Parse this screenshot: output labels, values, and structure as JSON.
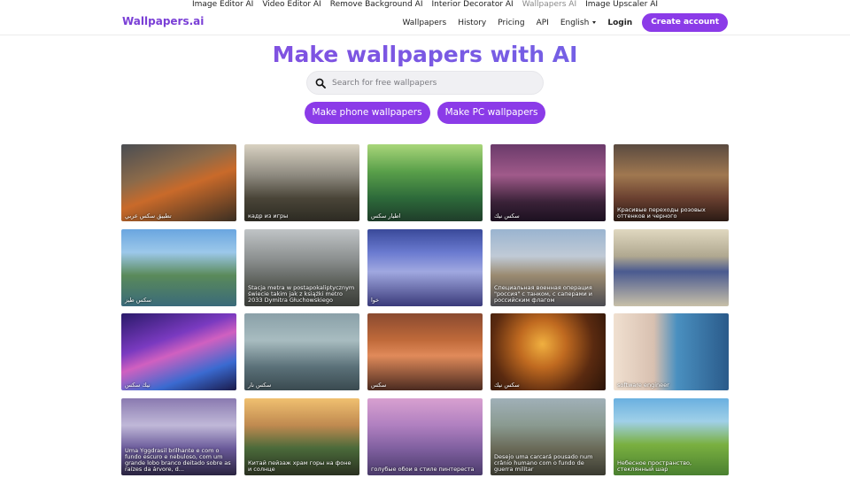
{
  "top_links": [
    {
      "label": "Image Editor AI",
      "active": false
    },
    {
      "label": "Video Editor AI",
      "active": false
    },
    {
      "label": "Remove Background AI",
      "active": false
    },
    {
      "label": "Interior Decorator AI",
      "active": false
    },
    {
      "label": "Wallpapers AI",
      "active": true
    },
    {
      "label": "Image Upscaler AI",
      "active": false
    }
  ],
  "header": {
    "logo": "Wallpapers.ai",
    "nav": {
      "wallpapers": "Wallpapers",
      "history": "History",
      "pricing": "Pricing",
      "api": "API",
      "language": "English",
      "login": "Login",
      "create_account": "Create account"
    }
  },
  "hero": {
    "title": "Make wallpapers with AI",
    "search_placeholder": "Search for free wallpapers",
    "phone_button": "Make phone wallpapers",
    "pc_button": "Make PC wallpapers"
  },
  "colors": {
    "accent": "#8b3be8",
    "logo": "#7a3fd6"
  },
  "icons": {
    "search": "search-icon",
    "dropdown": "chevron-down-icon"
  },
  "wallpapers": [
    {
      "caption": "تطبيق سكس عربي",
      "bg": "linear-gradient(160deg,#4a4d52 0%,#8b6a4a 35%,#c96a2a 55%,#3a2e22 100%)"
    },
    {
      "caption": "кадр из игры",
      "bg": "linear-gradient(180deg,#d9d2c2 0%,#8e8a80 40%,#4a4538 70%,#2c2a22 100%)"
    },
    {
      "caption": "اطيار سكس",
      "bg": "linear-gradient(180deg,#a9d67a 0%,#5aa04a 35%,#2d6a3a 70%,#1f3d2a 100%)"
    },
    {
      "caption": "سكس نيك",
      "bg": "linear-gradient(180deg,#6a3a6a 0%,#a05a8a 40%,#3a2238 75%,#1c1020 100%)"
    },
    {
      "caption": "Красивые переходы розовых оттенков и черного",
      "bg": "linear-gradient(180deg,#5a4a40 0%,#a07850 40%,#6a4030 70%,#2a1a14 100%)"
    },
    {
      "caption": "سكس طيز",
      "bg": "linear-gradient(180deg,#6aa6e0 0%,#9cc8ea 30%,#5a8a5a 60%,#3a6a7a 100%)"
    },
    {
      "caption": "Stacja metra w postapokaliptycznym świecie takim jak z książki metro 2033 Dymitra Głuchowskiego",
      "bg": "linear-gradient(180deg,#c0c4c6 0%,#8a8e8e 40%,#5a5e58 70%,#3a3c38 100%)"
    },
    {
      "caption": "خوا",
      "bg": "linear-gradient(180deg,#3a4a9a 0%,#6a7ad0 30%,#a0a8e0 55%,#3a3a7a 100%)"
    },
    {
      "caption": "Специальная военная операция \"россия\" с танком, с саперами и российским флагом",
      "bg": "linear-gradient(180deg,#9ab4d0 0%,#c0cad6 35%,#9a8a70 60%,#4a4a50 100%)"
    },
    {
      "caption": "",
      "bg": "linear-gradient(180deg,#e0d8c0 0%,#b0a890 35%,#4a5a90 55%,#c8c0a8 100%)"
    },
    {
      "caption": "نيك سكس",
      "bg": "linear-gradient(160deg,#2a1a6a 0%,#7a3ac0 35%,#d060c0 50%,#3a6ad0 75%,#1a1a4a 100%)"
    },
    {
      "caption": "سكس نار",
      "bg": "linear-gradient(180deg,#8aa0a8 0%,#a8bcc0 35%,#5a7078 70%,#3a4a50 100%)"
    },
    {
      "caption": "سكس",
      "bg": "linear-gradient(180deg,#8a4a30 0%,#c06a3a 35%,#e08a5a 55%,#4a2a20 100%)"
    },
    {
      "caption": "سكس نيك",
      "bg": "radial-gradient(circle at 45% 40%,#f0b040 0%,#c06a20 30%,#5a2a10 65%,#2a1408 100%)"
    },
    {
      "caption": "software engineer",
      "bg": "linear-gradient(90deg,#f0e0d0 0%,#d8c0b0 35%,#4a90c0 55%,#2a5a8a 100%)"
    },
    {
      "caption": "Uma Yggdrasil brilhante e com o fundo escuro e nebuloso, com um grande lobo branco deitado sobre as raízes da árvore, d...",
      "bg": "linear-gradient(180deg,#8a7ab0 0%,#c0b8d8 35%,#6a5a9a 65%,#2a2440 100%)"
    },
    {
      "caption": "Китай пейзаж храм горы на фоне и солнце",
      "bg": "linear-gradient(180deg,#f0c070 0%,#c08a50 35%,#4a6a3a 65%,#2a3020 100%)"
    },
    {
      "caption": "голубые обои в стиле пинтереста",
      "bg": "linear-gradient(180deg,#d8a0d0 0%,#b080c0 35%,#8060a0 65%,#4a3a6a 100%)"
    },
    {
      "caption": "Desejo uma carcará pousado num crânio humano com o fundo de guerra militar",
      "bg": "linear-gradient(180deg,#a0b0b8 0%,#8a9a90 35%,#6a6a58 65%,#3a3a30 100%)"
    },
    {
      "caption": "Небесное пространство, стеклянный шар",
      "bg": "linear-gradient(180deg,#6ab0e0 0%,#a0d0e8 30%,#7ab040 60%,#4a8030 100%)"
    }
  ]
}
